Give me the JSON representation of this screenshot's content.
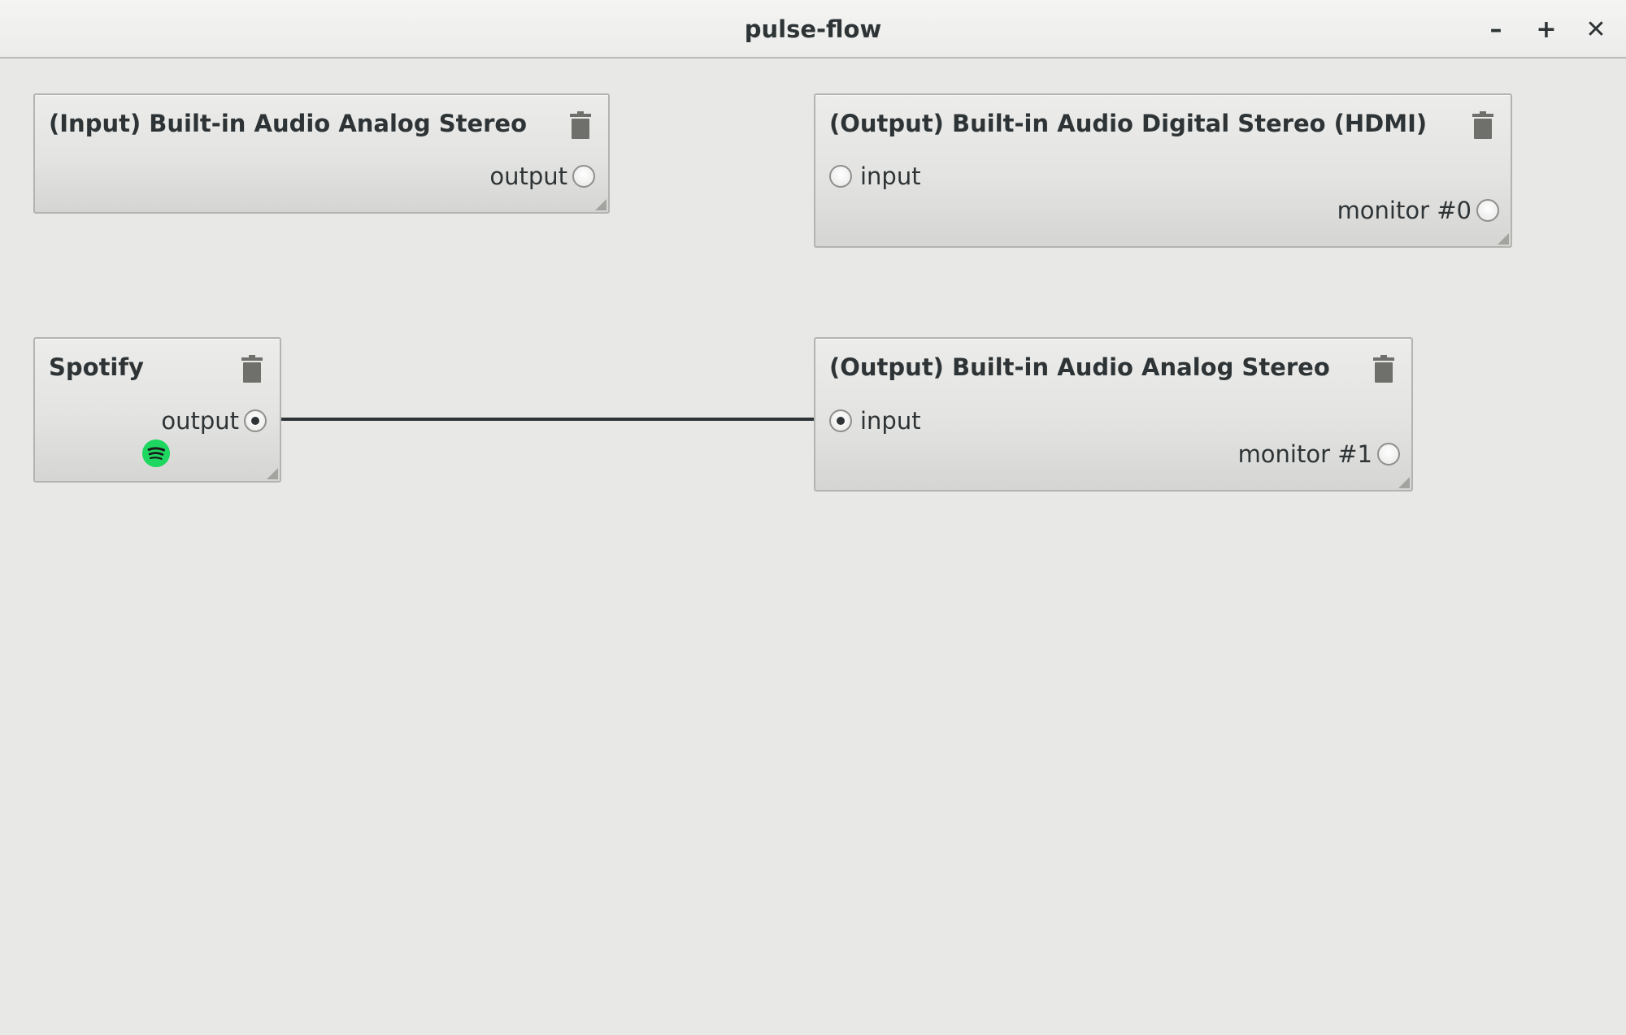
{
  "window": {
    "title": "pulse-flow",
    "minimize_label": "–",
    "maximize_label": "+",
    "close_label": "✕"
  },
  "nodes": [
    {
      "title": "(Input) Built-in Audio Analog Stereo",
      "ports": [
        {
          "label": "output",
          "side": "right",
          "connected": false
        }
      ]
    },
    {
      "title": "(Output) Built-in Audio Digital Stereo (HDMI)",
      "ports": [
        {
          "label": "input",
          "side": "left",
          "connected": false
        },
        {
          "label": "monitor #0",
          "side": "right",
          "connected": false
        }
      ]
    },
    {
      "title": "Spotify",
      "ports": [
        {
          "label": "output",
          "side": "right",
          "connected": true
        }
      ],
      "icon": "spotify-icon"
    },
    {
      "title": "(Output) Built-in Audio Analog Stereo",
      "ports": [
        {
          "label": "input",
          "side": "left",
          "connected": true
        },
        {
          "label": "monitor #1",
          "side": "right",
          "connected": false
        }
      ]
    }
  ],
  "connections": [
    {
      "from": "Spotify.output",
      "to": "(Output) Built-in Audio Analog Stereo.input"
    }
  ],
  "colors": {
    "background": "#e8e8e7",
    "text": "#2e3436",
    "wire": "#2e3436",
    "spotify": "#1ed760"
  }
}
